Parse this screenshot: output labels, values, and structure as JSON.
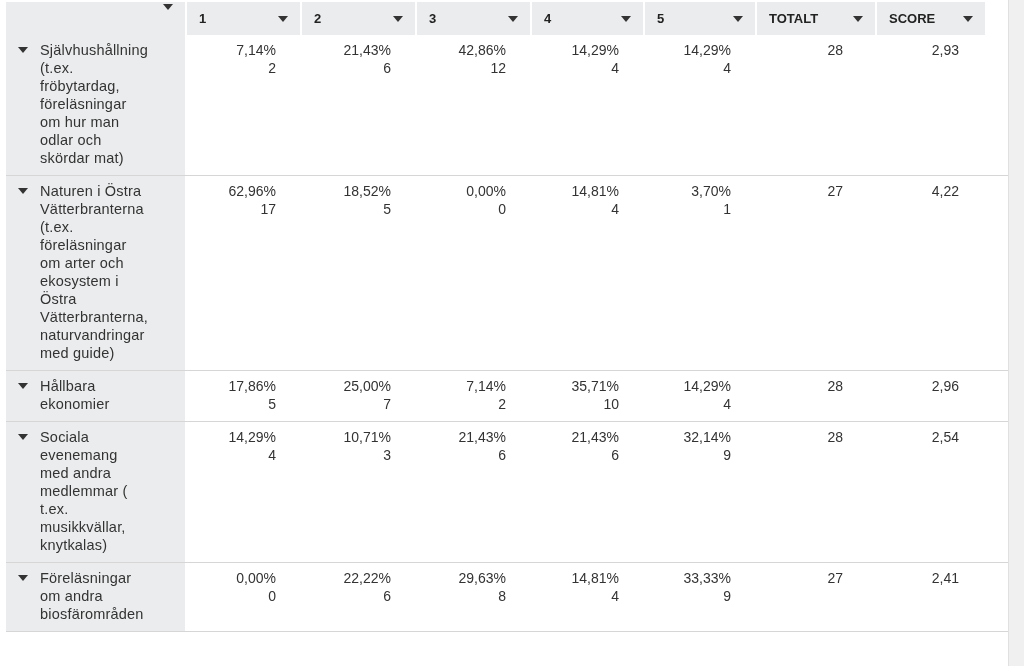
{
  "table": {
    "columns": [
      {},
      {
        "label": "1"
      },
      {
        "label": "2"
      },
      {
        "label": "3"
      },
      {
        "label": "4"
      },
      {
        "label": "5"
      },
      {
        "label": "TOTALT"
      },
      {
        "label": "SCORE"
      }
    ],
    "rows": [
      {
        "label": "Självhushållning (t.ex. fröbytardag, föreläsningar om hur man odlar och skördar mat)",
        "expanded": true,
        "cells": [
          {
            "percent": "7,14%",
            "count": "2"
          },
          {
            "percent": "21,43%",
            "count": "6"
          },
          {
            "percent": "42,86%",
            "count": "12"
          },
          {
            "percent": "14,29%",
            "count": "4"
          },
          {
            "percent": "14,29%",
            "count": "4"
          }
        ],
        "total": "28",
        "score": "2,93"
      },
      {
        "label": "Naturen i Östra Vätterbranterna (t.ex. föreläsningar om arter och ekosystem i Östra Vätterbranterna, naturvandringar med guide)",
        "expanded": true,
        "cells": [
          {
            "percent": "62,96%",
            "count": "17"
          },
          {
            "percent": "18,52%",
            "count": "5"
          },
          {
            "percent": "0,00%",
            "count": "0"
          },
          {
            "percent": "14,81%",
            "count": "4"
          },
          {
            "percent": "3,70%",
            "count": "1"
          }
        ],
        "total": "27",
        "score": "4,22"
      },
      {
        "label": "Hållbara ekonomier",
        "expanded": true,
        "cells": [
          {
            "percent": "17,86%",
            "count": "5"
          },
          {
            "percent": "25,00%",
            "count": "7"
          },
          {
            "percent": "7,14%",
            "count": "2"
          },
          {
            "percent": "35,71%",
            "count": "10"
          },
          {
            "percent": "14,29%",
            "count": "4"
          }
        ],
        "total": "28",
        "score": "2,96"
      },
      {
        "label": "Sociala evenemang med andra medlemmar ( t.ex. musikkvällar, knytkalas)",
        "expanded": true,
        "cells": [
          {
            "percent": "14,29%",
            "count": "4"
          },
          {
            "percent": "10,71%",
            "count": "3"
          },
          {
            "percent": "21,43%",
            "count": "6"
          },
          {
            "percent": "21,43%",
            "count": "6"
          },
          {
            "percent": "32,14%",
            "count": "9"
          }
        ],
        "total": "28",
        "score": "2,54"
      },
      {
        "label": "Föreläsningar om andra biosfärområden",
        "expanded": true,
        "cells": [
          {
            "percent": "0,00%",
            "count": "0"
          },
          {
            "percent": "22,22%",
            "count": "6"
          },
          {
            "percent": "29,63%",
            "count": "8"
          },
          {
            "percent": "14,81%",
            "count": "4"
          },
          {
            "percent": "33,33%",
            "count": "9"
          }
        ],
        "total": "27",
        "score": "2,41"
      }
    ]
  }
}
